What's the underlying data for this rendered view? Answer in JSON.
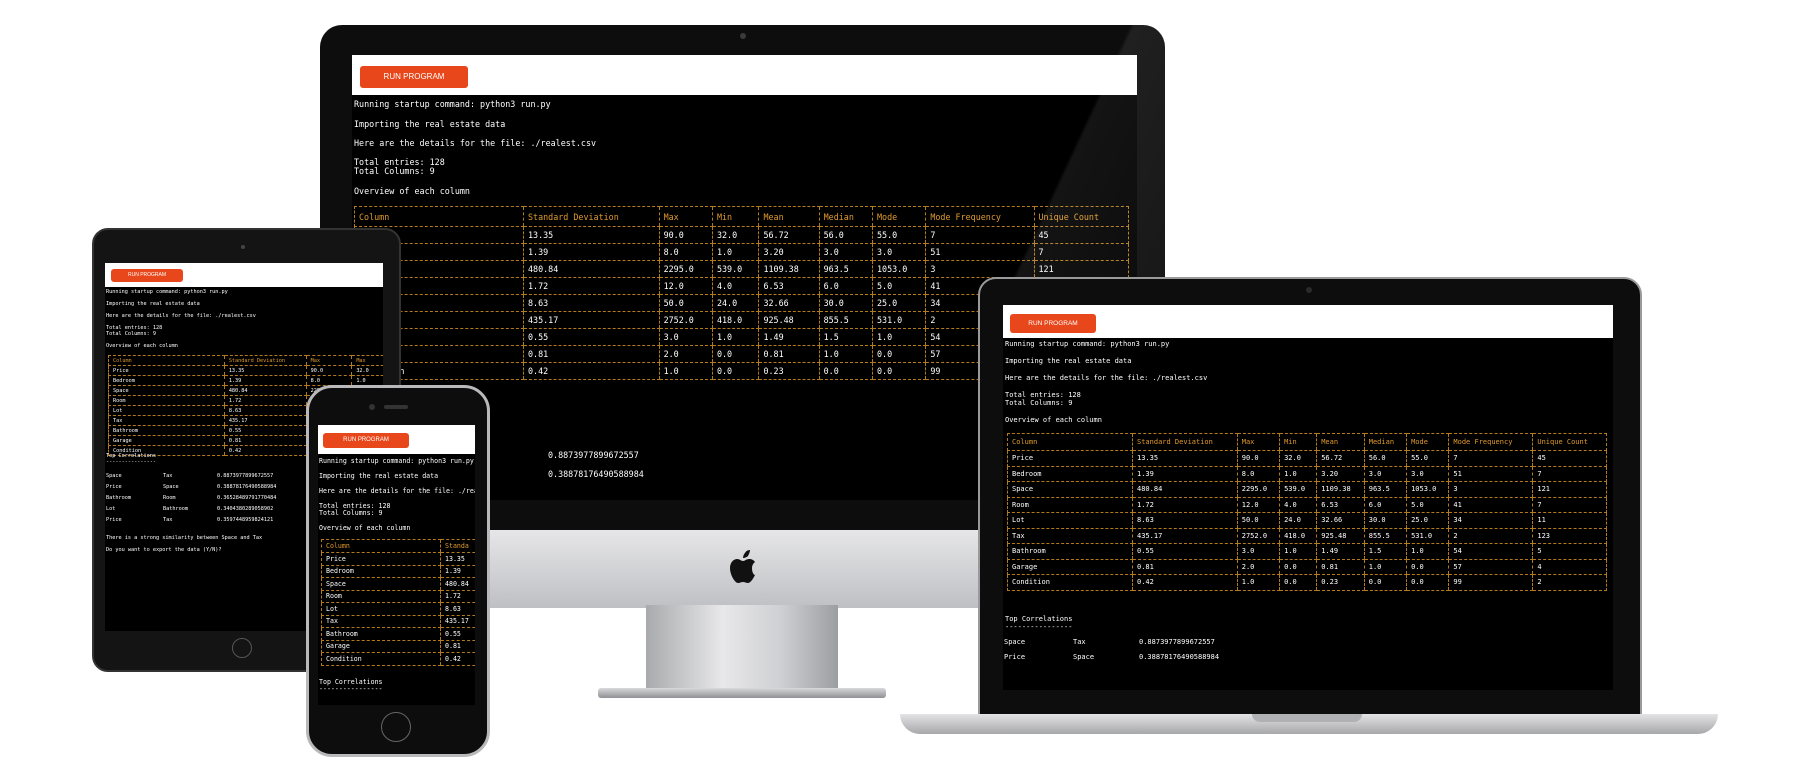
{
  "button_label": "RUN PROGRAM",
  "terminal_lines": [
    "Running startup command: python3 run.py",
    "Importing the real estate data",
    "Here are the details for the file: ./realest.csv",
    "Total entries: 128",
    "Total Columns: 9",
    "Overview of each column"
  ],
  "table": {
    "headers": [
      "Column",
      "Standard Deviation",
      "Max",
      "Min",
      "Mean",
      "Median",
      "Mode",
      "Mode Frequency",
      "Unique Count"
    ],
    "rows": [
      [
        "Price",
        "13.35",
        "90.0",
        "32.0",
        "56.72",
        "56.0",
        "55.0",
        "7",
        "45"
      ],
      [
        "Bedroom",
        "1.39",
        "8.0",
        "1.0",
        "3.20",
        "3.0",
        "3.0",
        "51",
        "7"
      ],
      [
        "Space",
        "480.84",
        "2295.0",
        "539.0",
        "1109.38",
        "963.5",
        "1053.0",
        "3",
        "121"
      ],
      [
        "Room",
        "1.72",
        "12.0",
        "4.0",
        "6.53",
        "6.0",
        "5.0",
        "41",
        "7"
      ],
      [
        "Lot",
        "8.63",
        "50.0",
        "24.0",
        "32.66",
        "30.0",
        "25.0",
        "34",
        "11"
      ],
      [
        "Tax",
        "435.17",
        "2752.0",
        "418.0",
        "925.48",
        "855.5",
        "531.0",
        "2",
        "123"
      ],
      [
        "Bathroom",
        "0.55",
        "3.0",
        "1.0",
        "1.49",
        "1.5",
        "1.0",
        "54",
        "5"
      ],
      [
        "Garage",
        "0.81",
        "2.0",
        "0.0",
        "0.81",
        "1.0",
        "0.0",
        "57",
        "4"
      ],
      [
        "Condition",
        "0.42",
        "1.0",
        "0.0",
        "0.23",
        "0.0",
        "0.0",
        "99",
        "2"
      ]
    ]
  },
  "correlations_title": "Top Correlations",
  "correlations_underline": "----------------",
  "correlations": [
    [
      "Space",
      "Tax",
      "0.8873977899672557"
    ],
    [
      "Price",
      "Space",
      "0.38878176490588984"
    ],
    [
      "Bathroom",
      "Room",
      "0.36528489791770484"
    ],
    [
      "Lot",
      "Bathroom",
      "0.3404380289058902"
    ],
    [
      "Price",
      "Tax",
      "0.3597448959824121"
    ]
  ],
  "similarity_text": "There is a strong similarity between Space and Tax",
  "export_prompt": "Do you want to export the data (Y/N)?",
  "phone_partial_details": "Here are the details for the file: ./real",
  "phone_partial_header": "Standa",
  "tablet_partial_header": "Max"
}
